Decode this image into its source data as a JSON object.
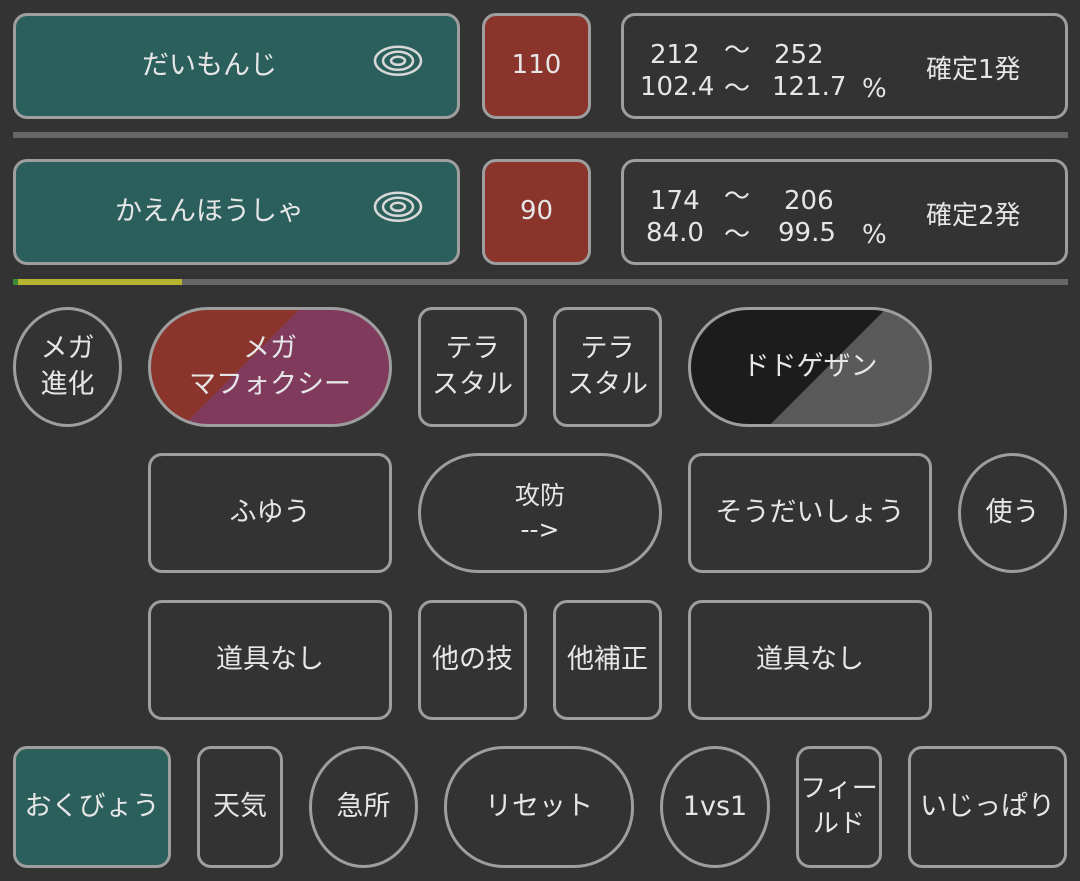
{
  "moves": [
    {
      "name": "だいもんじ",
      "power": "110",
      "damage_min": "212",
      "damage_max": "252",
      "pct_min": "102.4",
      "pct_max": "121.7",
      "tilde": "〜",
      "pct_sign": "%",
      "result": "確定1発"
    },
    {
      "name": "かえんほうしゃ",
      "power": "90",
      "damage_min": "174",
      "damage_max": "206",
      "pct_min": "84.0",
      "pct_max": "99.5",
      "tilde": "〜",
      "pct_sign": "%",
      "result": "確定2発"
    }
  ],
  "hp_bar": {
    "fill_fraction": 0.16,
    "color": "#b5b530"
  },
  "row1": {
    "mega_evolve": "メガ\n進化",
    "pokemon": "メガ\nマフォクシー",
    "tera_left": "テラ\nスタル",
    "tera_right": "テラ\nスタル",
    "opponent": "ドドゲザン"
  },
  "row2": {
    "ability_left": "ふゆう",
    "direction": "攻防\n-->",
    "ability_right": "そうだいしょう",
    "use": "使う"
  },
  "row3": {
    "item_left": "道具なし",
    "other_move": "他の技",
    "other_mod": "他補正",
    "item_right": "道具なし"
  },
  "row4": {
    "nature_left": "おくびょう",
    "weather": "天気",
    "critical": "急所",
    "reset": "リセット",
    "mode": "1vs1",
    "field": "フィー\nルド",
    "nature_right": "いじっぱり"
  },
  "colors": {
    "teal": "#2b5f5c",
    "red": "#8a342b",
    "pokemon_gradient": [
      "#8a342b",
      "#7f3a5c"
    ],
    "opponent_gradient": [
      "#1c1c1c",
      "#5a5a5a"
    ]
  }
}
